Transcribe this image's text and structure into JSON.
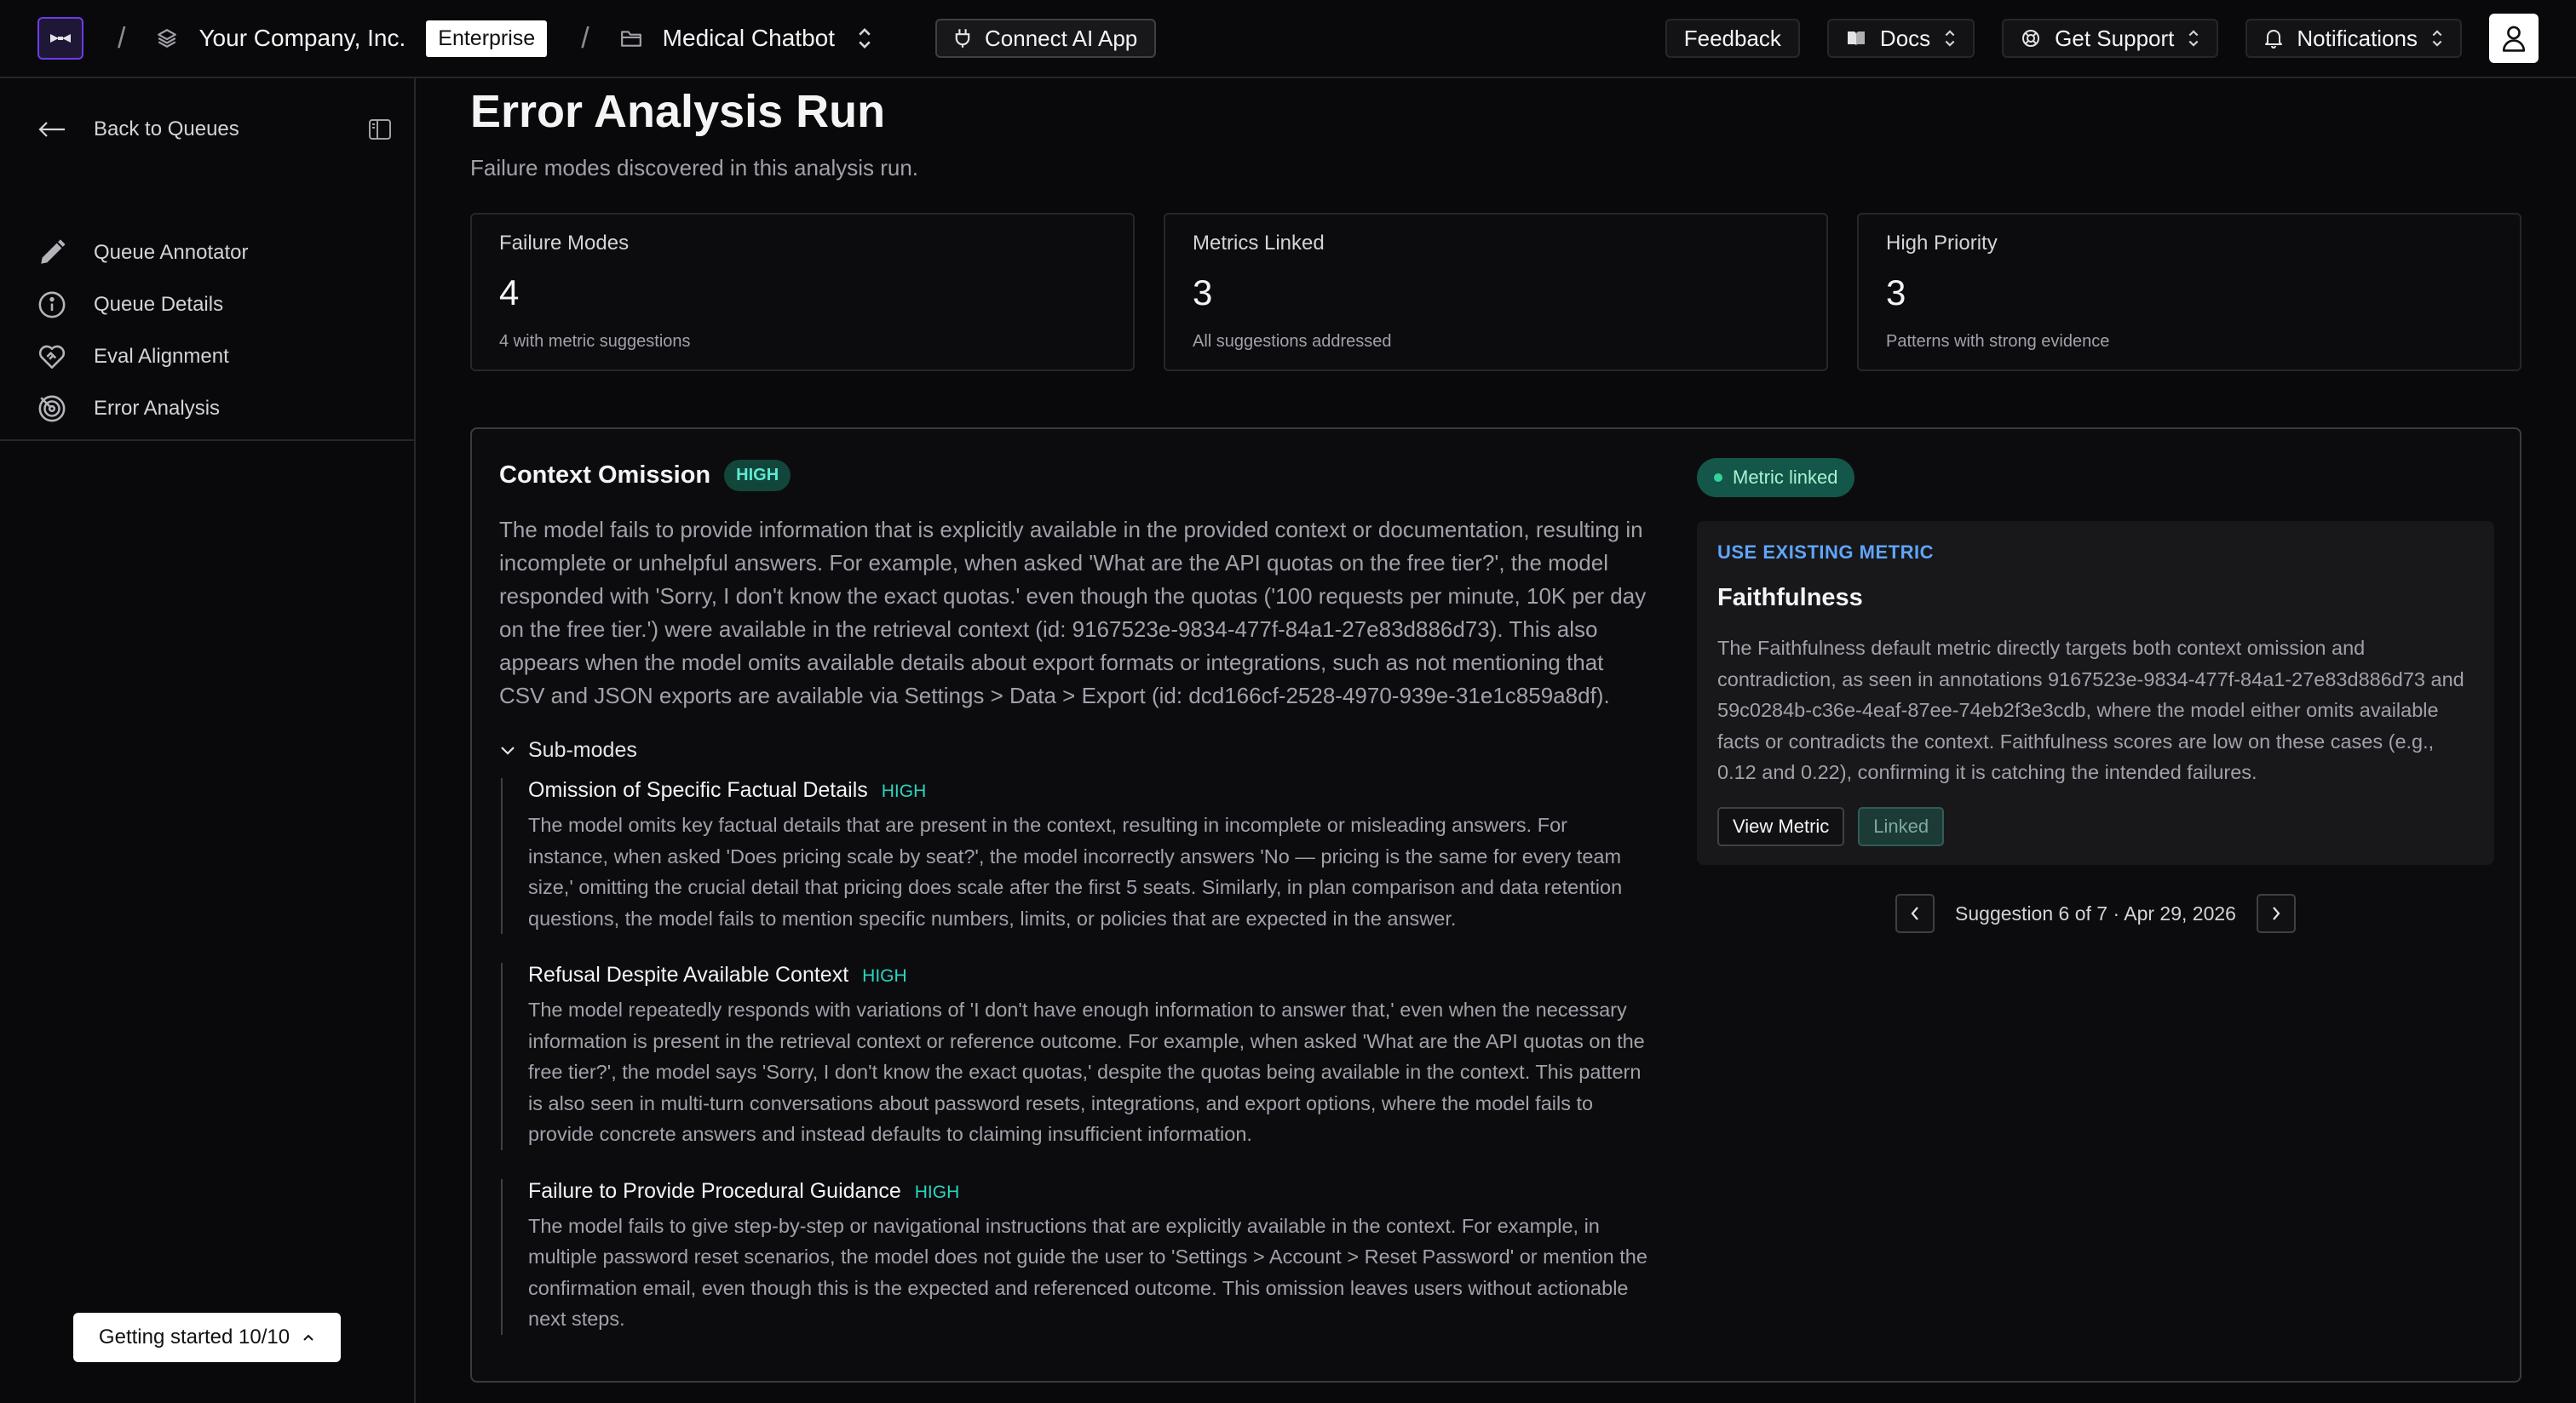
{
  "topbar": {
    "org_name": "Your Company, Inc.",
    "org_plan": "Enterprise",
    "project_name": "Medical Chatbot",
    "connect_label": "Connect AI App",
    "feedback_label": "Feedback",
    "docs_label": "Docs",
    "support_label": "Get Support",
    "notifications_label": "Notifications"
  },
  "sidebar": {
    "back_label": "Back to Queues",
    "items": [
      {
        "label": "Queue Annotator",
        "icon": "pencil-icon"
      },
      {
        "label": "Queue Details",
        "icon": "info-icon"
      },
      {
        "label": "Eval Alignment",
        "icon": "heart-handshake-icon"
      },
      {
        "label": "Error Analysis",
        "icon": "target-icon"
      }
    ],
    "getting_started": "Getting started 10/10"
  },
  "page": {
    "title": "Error Analysis Run",
    "subtitle": "Failure modes discovered in this analysis run."
  },
  "stats": [
    {
      "label": "Failure Modes",
      "value": "4",
      "note": "4 with metric suggestions"
    },
    {
      "label": "Metrics Linked",
      "value": "3",
      "note": "All suggestions addressed"
    },
    {
      "label": "High Priority",
      "value": "3",
      "note": "Patterns with strong evidence"
    }
  ],
  "failure_mode": {
    "title": "Context Omission",
    "priority": "HIGH",
    "description": "The model fails to provide information that is explicitly available in the provided context or documentation, resulting in incomplete or unhelpful answers. For example, when asked 'What are the API quotas on the free tier?', the model responded with 'Sorry, I don't know the exact quotas.' even though the quotas ('100 requests per minute, 10K per day on the free tier.') were available in the retrieval context (id: 9167523e-9834-477f-84a1-27e83d886d73). This also appears when the model omits available details about export formats or integrations, such as not mentioning that CSV and JSON exports are available via Settings > Data > Export (id: dcd166cf-2528-4970-939e-31e1c859a8df).",
    "submodes_label": "Sub-modes",
    "submodes": [
      {
        "title": "Omission of Specific Factual Details",
        "level": "HIGH",
        "description": "The model omits key factual details that are present in the context, resulting in incomplete or misleading answers. For instance, when asked 'Does pricing scale by seat?', the model incorrectly answers 'No — pricing is the same for every team size,' omitting the crucial detail that pricing does scale after the first 5 seats. Similarly, in plan comparison and data retention questions, the model fails to mention specific numbers, limits, or policies that are expected in the answer."
      },
      {
        "title": "Refusal Despite Available Context",
        "level": "HIGH",
        "description": "The model repeatedly responds with variations of 'I don't have enough information to answer that,' even when the necessary information is present in the retrieval context or reference outcome. For example, when asked 'What are the API quotas on the free tier?', the model says 'Sorry, I don't know the exact quotas,' despite the quotas being available in the context. This pattern is also seen in multi-turn conversations about password resets, integrations, and export options, where the model fails to provide concrete answers and instead defaults to claiming insufficient information."
      },
      {
        "title": "Failure to Provide Procedural Guidance",
        "level": "HIGH",
        "description": "The model fails to give step-by-step or navigational instructions that are explicitly available in the context. For example, in multiple password reset scenarios, the model does not guide the user to 'Settings > Account > Reset Password' or mention the confirmation email, even though this is the expected and referenced outcome. This omission leaves users without actionable next steps."
      }
    ]
  },
  "suggestion": {
    "status": "Metric linked",
    "kind": "USE EXISTING METRIC",
    "metric_name": "Faithfulness",
    "description": "The Faithfulness default metric directly targets both context omission and contradiction, as seen in annotations 9167523e-9834-477f-84a1-27e83d886d73 and 59c0284b-c36e-4eaf-87ee-74eb2f3e3cdb, where the model either omits available facts or contradicts the context. Faithfulness scores are low on these cases (e.g., 0.12 and 0.22), confirming it is catching the intended failures.",
    "view_label": "View Metric",
    "linked_label": "Linked",
    "pager_text": "Suggestion 6 of 7 · Apr 29, 2026"
  },
  "colors": {
    "background": "#09090b",
    "accent_purple": "#6d3be8",
    "high_badge": "#12463b",
    "teal": "#2dd4bf",
    "link_blue": "#60a5fa"
  }
}
